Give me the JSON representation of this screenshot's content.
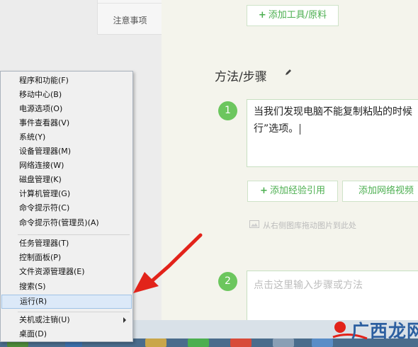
{
  "sidebar": {
    "tab_label": "注意事项"
  },
  "editor": {
    "add_tools_label": "添加工具/原料",
    "section_title": "方法/步骤",
    "steps": [
      {
        "number": "1",
        "text_line1": "当我们发现电脑不能复制粘贴的时候",
        "text_line2": "行”选项。"
      },
      {
        "number": "2",
        "placeholder": "点击这里输入步骤或方法"
      }
    ],
    "add_reference_label": "添加经验引用",
    "add_video_label": "添加网络视频",
    "image_hint": "从右侧图库拖动图片到此处",
    "accent_color": "#6cc65e"
  },
  "context_menu": {
    "items": [
      "程序和功能(F)",
      "移动中心(B)",
      "电源选项(O)",
      "事件查看器(V)",
      "系统(Y)",
      "设备管理器(M)",
      "网络连接(W)",
      "磁盘管理(K)",
      "计算机管理(G)",
      "命令提示符(C)",
      "命令提示符(管理员)(A)",
      "任务管理器(T)",
      "控制面板(P)",
      "文件资源管理器(E)",
      "搜索(S)",
      "运行(R)",
      "关机或注销(U)",
      "桌面(D)"
    ],
    "highlighted": "运行(R)",
    "arrow_color": "#e2231a"
  },
  "watermark": {
    "text": "广西龙网"
  }
}
